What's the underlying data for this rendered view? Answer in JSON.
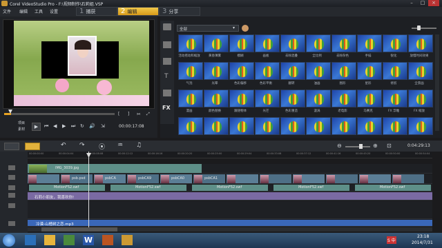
{
  "window": {
    "title": "Corel VideoStudio Pro - F:\\视频制作\\石莉姐.VSP"
  },
  "menu": [
    "文件",
    "编辑",
    "工具",
    "设置"
  ],
  "steps": [
    {
      "num": "1",
      "label": "捕获"
    },
    {
      "num": "2",
      "label": "编辑"
    },
    {
      "num": "3",
      "label": "分享"
    }
  ],
  "player": {
    "project_label": "项目",
    "clip_label": "素材",
    "timecode": "00:00:17:08"
  },
  "library": {
    "filter_value": "全部",
    "rows": [
      [
        "活动摇动和缩放",
        "黄昏薄雾",
        "模糊",
        "画板",
        "去除混叠",
        "全比例",
        "去除杂色",
        "手描",
        "锐化",
        "放慢时间效果"
      ],
      [
        "气泡",
        "光晕",
        "色彩偏移",
        "色彩平衡",
        "翻转",
        "油画",
        "图形",
        "星形",
        "修剪",
        "全景画"
      ],
      [
        "漫画",
        "颜色替换",
        "跟随物体",
        "光芒",
        "色彩重造",
        "漩涡",
        "老电影",
        "马赛克",
        "FX 浮雕",
        "FX 缩放"
      ],
      [
        "",
        "",
        "",
        "",
        "",
        "",
        "",
        "",
        "",
        ""
      ]
    ]
  },
  "timeline": {
    "timecode": "0:04:29:13",
    "ruler": [
      "00:00:00:00",
      "00:00:04:04",
      "00:00:08:08",
      "00:00:12:12",
      "00:00:16:16",
      "00:00:20:20",
      "00:00:25:00",
      "00:00:29:04",
      "00:00:33:08",
      "00:00:37:12",
      "00:00:41:16",
      "00:00:45:20",
      "00:00:50:00",
      "00:00:54:04"
    ],
    "overlay_clip": "IMG_3039.jpg",
    "video_clips": [
      "psb.psd",
      "psbCA",
      "psbCA9",
      "psbCA0",
      "psbCA1"
    ],
    "overlay2_clips": [
      "MotionF52.swf",
      "MotionF52.swf",
      "MotionF52.swf",
      "MotionF52.swf",
      "MotionF52.swf"
    ],
    "title_clip": "石莉小朋友，我喜欢你!",
    "music_clip": "冷漠-山楂树之恋.mp3"
  },
  "taskbar": {
    "time": "23:18",
    "date": "2014/7/31",
    "ime": "S 中"
  }
}
